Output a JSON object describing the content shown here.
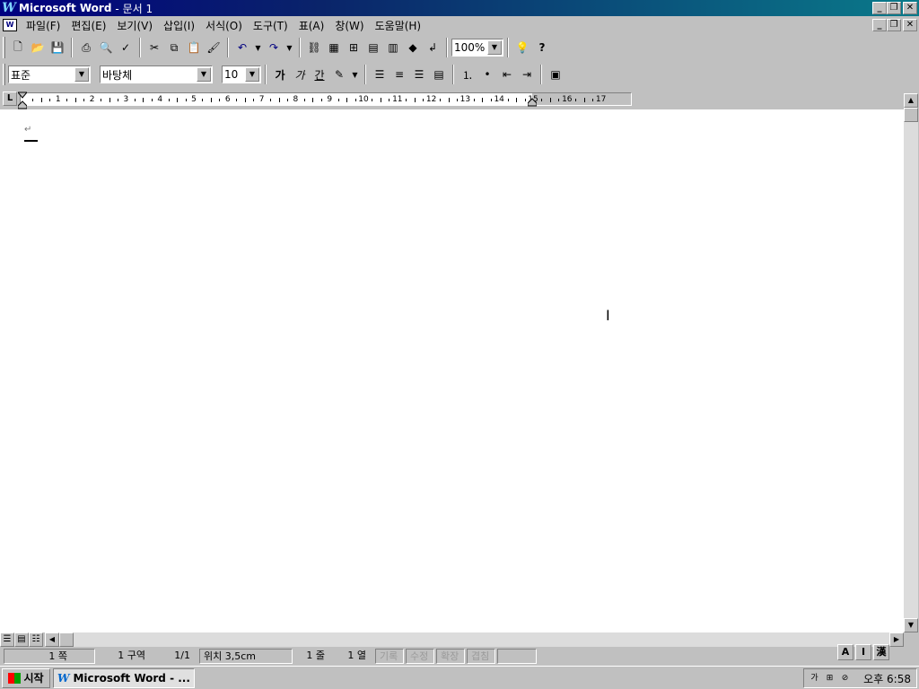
{
  "window": {
    "app_name": "Microsoft Word",
    "document": "- 문서 1"
  },
  "menu": [
    "파일(F)",
    "편집(E)",
    "보기(V)",
    "삽입(I)",
    "서식(O)",
    "도구(T)",
    "표(A)",
    "창(W)",
    "도움말(H)"
  ],
  "toolbar": {
    "zoom": "100%",
    "style": "표준",
    "font": "바탕체",
    "size": "10",
    "bold_label": "가",
    "italic_label": "가",
    "underline_label": "간"
  },
  "ruler": {
    "numbers": [
      "1",
      "2",
      "3",
      "4",
      "5",
      "6",
      "7",
      "8",
      "9",
      "10",
      "11",
      "12",
      "13",
      "14",
      "15",
      "16",
      "17"
    ]
  },
  "status": {
    "page": "1 쪽",
    "section": "1 구역",
    "page_of": "1/1",
    "position": "위치 3,5cm",
    "line": "1 줄",
    "column": "1 열",
    "mode_rec": "기록",
    "mode_trk": "수정",
    "mode_ext": "확장",
    "mode_ovr": "겹침"
  },
  "ime": [
    "A",
    "I",
    "漢"
  ],
  "taskbar": {
    "start": "시작",
    "word_task": "Microsoft Word - ...",
    "clock": "오후 6:58"
  },
  "colors": {
    "title_start": "#000080",
    "title_end": "#0a7a8a",
    "face": "#c0c0c0"
  }
}
